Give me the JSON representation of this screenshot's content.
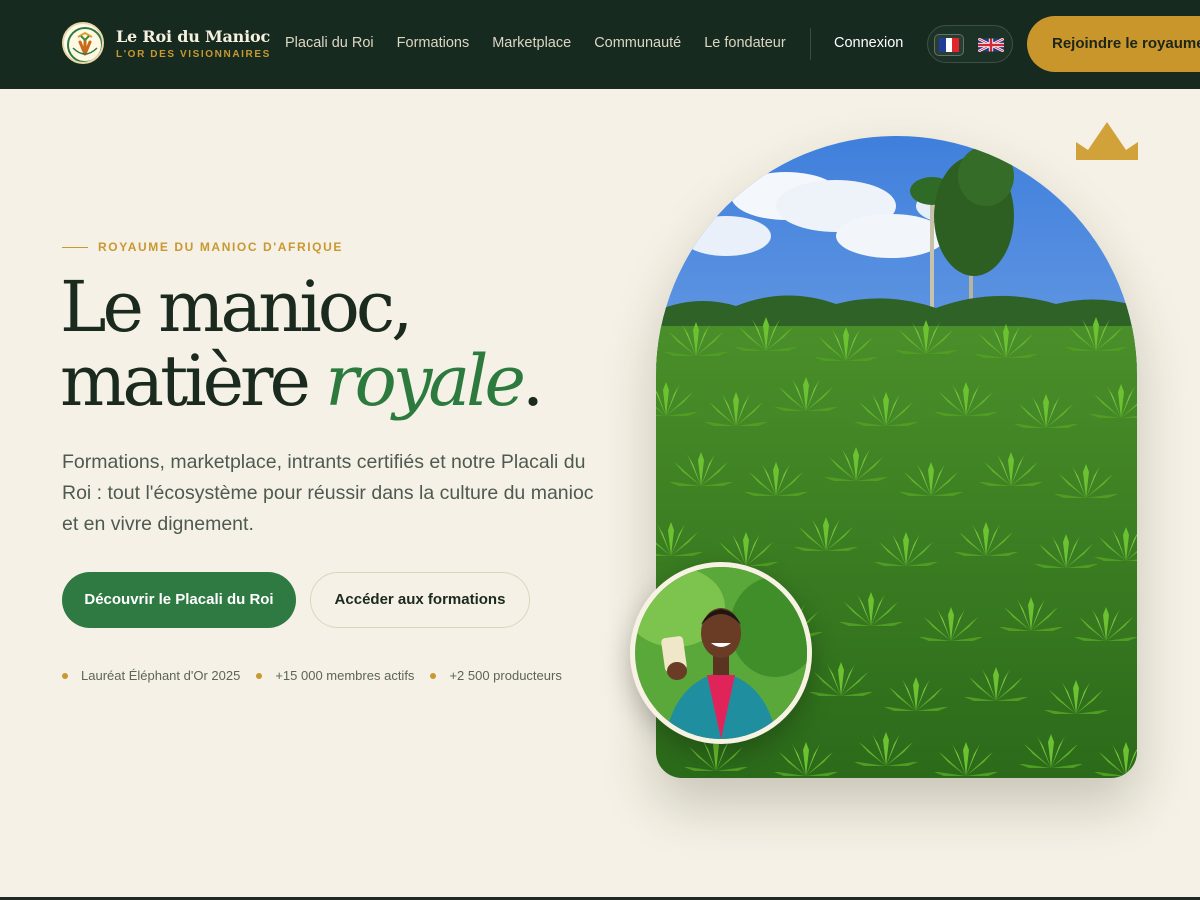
{
  "brand": {
    "name": "Le Roi du Manioc",
    "tagline": "L'OR DES VISIONNAIRES"
  },
  "nav": {
    "items": [
      "Placali du Roi",
      "Formations",
      "Marketplace",
      "Communauté",
      "Le fondateur"
    ],
    "login": "Connexion",
    "cta": "Rejoindre le royaume"
  },
  "languages": {
    "active": "fr",
    "options": [
      "fr",
      "en"
    ]
  },
  "hero": {
    "eyebrow": "ROYAUME DU MANIOC D'AFRIQUE",
    "title_line1": "Le manioc,",
    "title_line2_plain": "matière",
    "title_line2_emphasis": "royale",
    "title_line2_end": ".",
    "lead": "Formations, marketplace, intrants certifiés et notre Placali du Roi : tout l'écosystème pour réussir dans la culture du manioc et en vivre dignement.",
    "primary_cta": "Découvrir le Placali du Roi",
    "secondary_cta": "Accéder aux formations",
    "stats": [
      "Lauréat Éléphant d'Or 2025",
      "+15 000 membres actifs",
      "+2 500 producteurs"
    ]
  },
  "colors": {
    "header_bg": "#172a1f",
    "page_bg": "#f5f1e6",
    "gold": "#c9962c",
    "green": "#2e7a42"
  },
  "icons": {
    "crown": "crown-icon",
    "logo": "cassava-logo-icon",
    "flag_fr": "flag-france-icon",
    "flag_en": "flag-uk-icon"
  }
}
